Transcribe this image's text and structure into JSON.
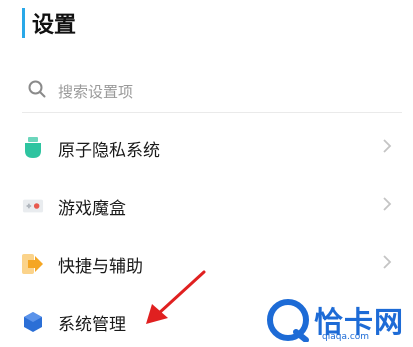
{
  "header": {
    "title": "设置"
  },
  "search": {
    "placeholder": "搜索设置项",
    "icon": "search-icon"
  },
  "settings_items": [
    {
      "label": "原子隐私系统",
      "icon": "privacy-shield-icon",
      "color": "#2ec4a0"
    },
    {
      "label": "游戏魔盒",
      "icon": "game-box-icon",
      "color": "#e85a4f"
    },
    {
      "label": "快捷与辅助",
      "icon": "shortcut-arrow-icon",
      "color": "#f5a623"
    },
    {
      "label": "系统管理",
      "icon": "system-hexagon-icon",
      "color": "#2b6fd6"
    }
  ],
  "annotation": {
    "icon": "red-arrow-icon",
    "color": "#e02020"
  },
  "watermark": {
    "text": "恰卡网",
    "url": "qiaqa.com",
    "color": "#1d6bd6"
  }
}
